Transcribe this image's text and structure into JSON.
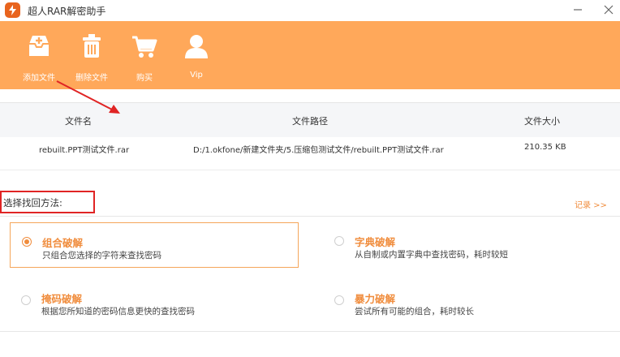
{
  "window": {
    "title": "超人RAR解密助手",
    "controls": [
      "minimize-icon",
      "close-icon"
    ]
  },
  "toolbar": {
    "items": [
      {
        "label": "添加文件",
        "icon": "add-file-icon"
      },
      {
        "label": "删除文件",
        "icon": "trash-icon"
      },
      {
        "label": "购买",
        "icon": "cart-icon"
      },
      {
        "label": "Vip",
        "icon": "user-icon"
      }
    ]
  },
  "file_table": {
    "columns": [
      "文件名",
      "文件路径",
      "文件大小"
    ],
    "rows": [
      {
        "name": "rebuilt.PPT测试文件.rar",
        "path": "D:/1.okfone/新建文件夹/5.压缩包测试文件/rebuilt.PPT测试文件.rar",
        "size": "210.35 KB"
      }
    ]
  },
  "methods": {
    "heading": "选择找回方法:",
    "record_link": "记录 >>",
    "options": [
      {
        "title": "组合破解",
        "desc": "只组合您选择的字符来查找密码",
        "selected": true
      },
      {
        "title": "字典破解",
        "desc": "从自制或内置字典中查找密码，耗时较短",
        "selected": false
      },
      {
        "title": "掩码破解",
        "desc": "根据您所知道的密码信息更快的查找密码",
        "selected": false
      },
      {
        "title": "暴力破解",
        "desc": "尝试所有可能的组合，耗时较长",
        "selected": false
      }
    ]
  },
  "colors": {
    "toolbar_bg": "#ffa85a",
    "accent": "#f08c3c",
    "annotation": "#e02424"
  }
}
